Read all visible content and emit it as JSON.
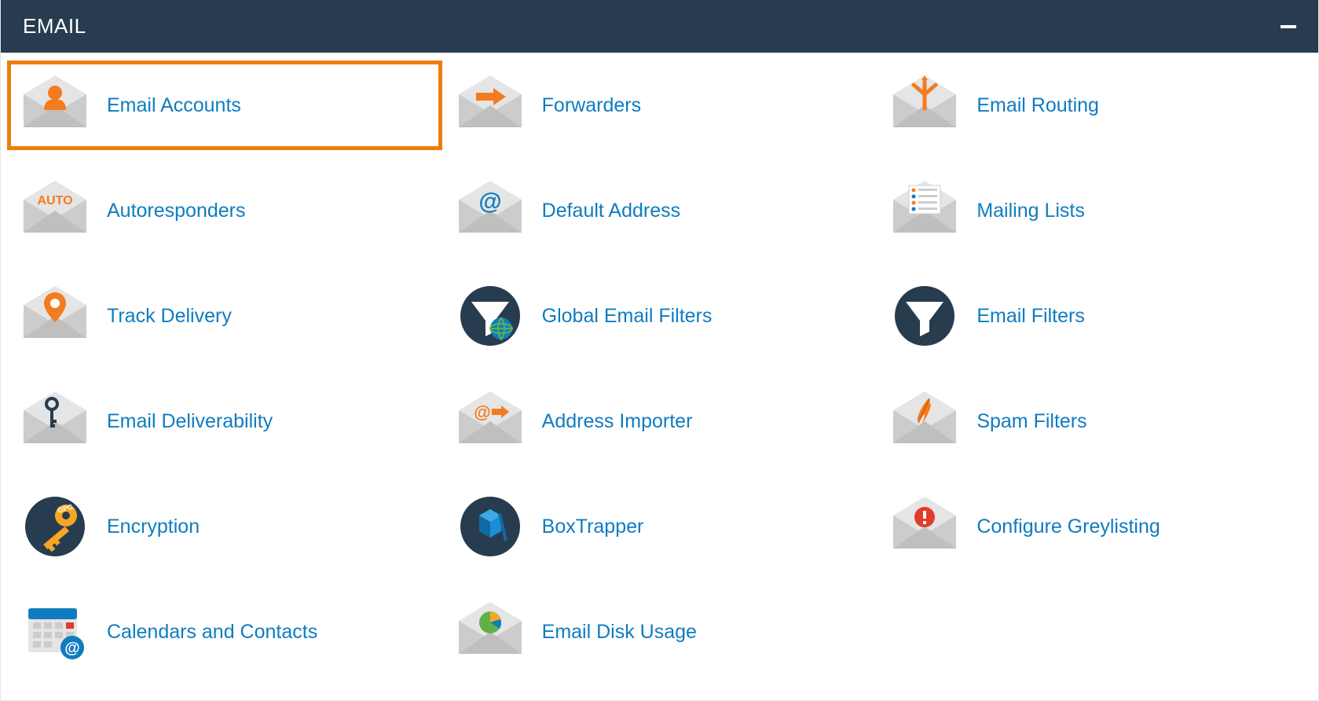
{
  "panel": {
    "title": "EMAIL",
    "colors": {
      "headerBg": "#283c50",
      "link": "#0f7cc0",
      "highlight": "#ed7e0c",
      "envelopeLight": "#e5e5e5",
      "envelopeMed": "#cccccc",
      "envelopeDark": "#bfbfbf",
      "accentOrange": "#f57b1f",
      "darkCircle": "#283c50"
    },
    "items": [
      {
        "label": "Email Accounts",
        "icon": "email-accounts",
        "highlighted": true
      },
      {
        "label": "Forwarders",
        "icon": "forwarders",
        "highlighted": false
      },
      {
        "label": "Email Routing",
        "icon": "email-routing",
        "highlighted": false
      },
      {
        "label": "Autoresponders",
        "icon": "autoresponders",
        "highlighted": false
      },
      {
        "label": "Default Address",
        "icon": "default-address",
        "highlighted": false
      },
      {
        "label": "Mailing Lists",
        "icon": "mailing-lists",
        "highlighted": false
      },
      {
        "label": "Track Delivery",
        "icon": "track-delivery",
        "highlighted": false
      },
      {
        "label": "Global Email Filters",
        "icon": "global-email-filters",
        "highlighted": false
      },
      {
        "label": "Email Filters",
        "icon": "email-filters",
        "highlighted": false
      },
      {
        "label": "Email Deliverability",
        "icon": "email-deliverability",
        "highlighted": false
      },
      {
        "label": "Address Importer",
        "icon": "address-importer",
        "highlighted": false
      },
      {
        "label": "Spam Filters",
        "icon": "spam-filters",
        "highlighted": false
      },
      {
        "label": "Encryption",
        "icon": "encryption",
        "highlighted": false
      },
      {
        "label": "BoxTrapper",
        "icon": "boxtrapper",
        "highlighted": false
      },
      {
        "label": "Configure Greylisting",
        "icon": "configure-greylisting",
        "highlighted": false
      },
      {
        "label": "Calendars and Contacts",
        "icon": "calendars-and-contacts",
        "highlighted": false
      },
      {
        "label": "Email Disk Usage",
        "icon": "email-disk-usage",
        "highlighted": false
      }
    ]
  }
}
